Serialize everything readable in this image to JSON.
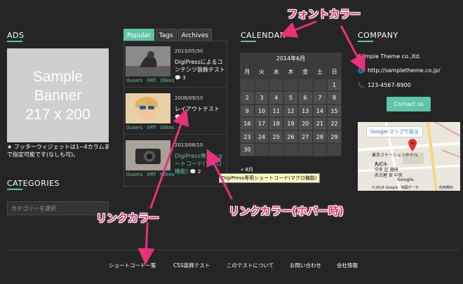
{
  "ads": {
    "heading": "ADS",
    "banner_lines": [
      "Sample",
      "Banner",
      "217 x 200"
    ],
    "note": "★ フッターウィジェットは1~4カラムまで指定可能です(なしも可)。"
  },
  "categories": {
    "heading": "CATEGORIES",
    "select_value": "カテゴリーを選択"
  },
  "tabs": [
    {
      "label": "Popular",
      "active": true
    },
    {
      "label": "Tags",
      "active": false
    },
    {
      "label": "Archives",
      "active": false
    }
  ],
  "posts": [
    {
      "date": "2013/05/30",
      "title": "DigiPressによるコンテンツ装飾テスト",
      "comment_count": "3",
      "tags": [
        "0users",
        "0RT",
        "0likes"
      ]
    },
    {
      "date": "2008/09/10",
      "title": "レイアウトテスト",
      "comment_count": "3",
      "tags": [
        "0users",
        "0RT",
        "0likes"
      ]
    },
    {
      "date": "2013/08/10",
      "title": "DigiPress専用ショートコード(マクロ機能)",
      "comment_count": "2",
      "tags": [
        "0users",
        "0RT",
        "0likes"
      ]
    }
  ],
  "tooltip": "DigiPress専用ショートコード(マクロ機能)",
  "calendar": {
    "heading": "CALENDAR",
    "caption": "2014年6月",
    "weekdays": [
      "月",
      "火",
      "水",
      "木",
      "金",
      "土",
      "日"
    ],
    "days": [
      "",
      "",
      "",
      "",
      "",
      "",
      "1",
      "2",
      "3",
      "4",
      "5",
      "6",
      "7",
      "8",
      "9",
      "10",
      "11",
      "12",
      "13",
      "14",
      "15",
      "16",
      "17",
      "18",
      "19",
      "20",
      "21",
      "22",
      "23",
      "24",
      "25",
      "26",
      "27",
      "28",
      "29",
      "30",
      "",
      "",
      "",
      "",
      "",
      ""
    ],
    "prev_link": "« 8月"
  },
  "company": {
    "heading": "COMPANY",
    "name": "Sample Theme co.,ltd.",
    "url": "http://sampletheme.co.jp/",
    "phone": "123-4567-8900",
    "contact_button": "Contact us",
    "map_button": "Google マップで見る",
    "map_labels": [
      "東京ステーションホテル",
      "丸ビル",
      "中央 区 銀座",
      "名古屋 官 中央",
      "©2014 Google · 地図データ",
      "利用規約",
      "Google"
    ]
  },
  "footer_links": [
    "ショートコード一覧",
    "CSS装飾テスト",
    "このテストについて",
    "お問い合わせ",
    "会社情報"
  ],
  "annotations": {
    "font_color": "フォントカラー",
    "link_color": "リンクカラー",
    "link_hover_color": "リンクカラー(ホバー時)"
  },
  "colors": {
    "accent": "#5fc4a8",
    "background": "#252525",
    "annotation": "#e8317a"
  }
}
